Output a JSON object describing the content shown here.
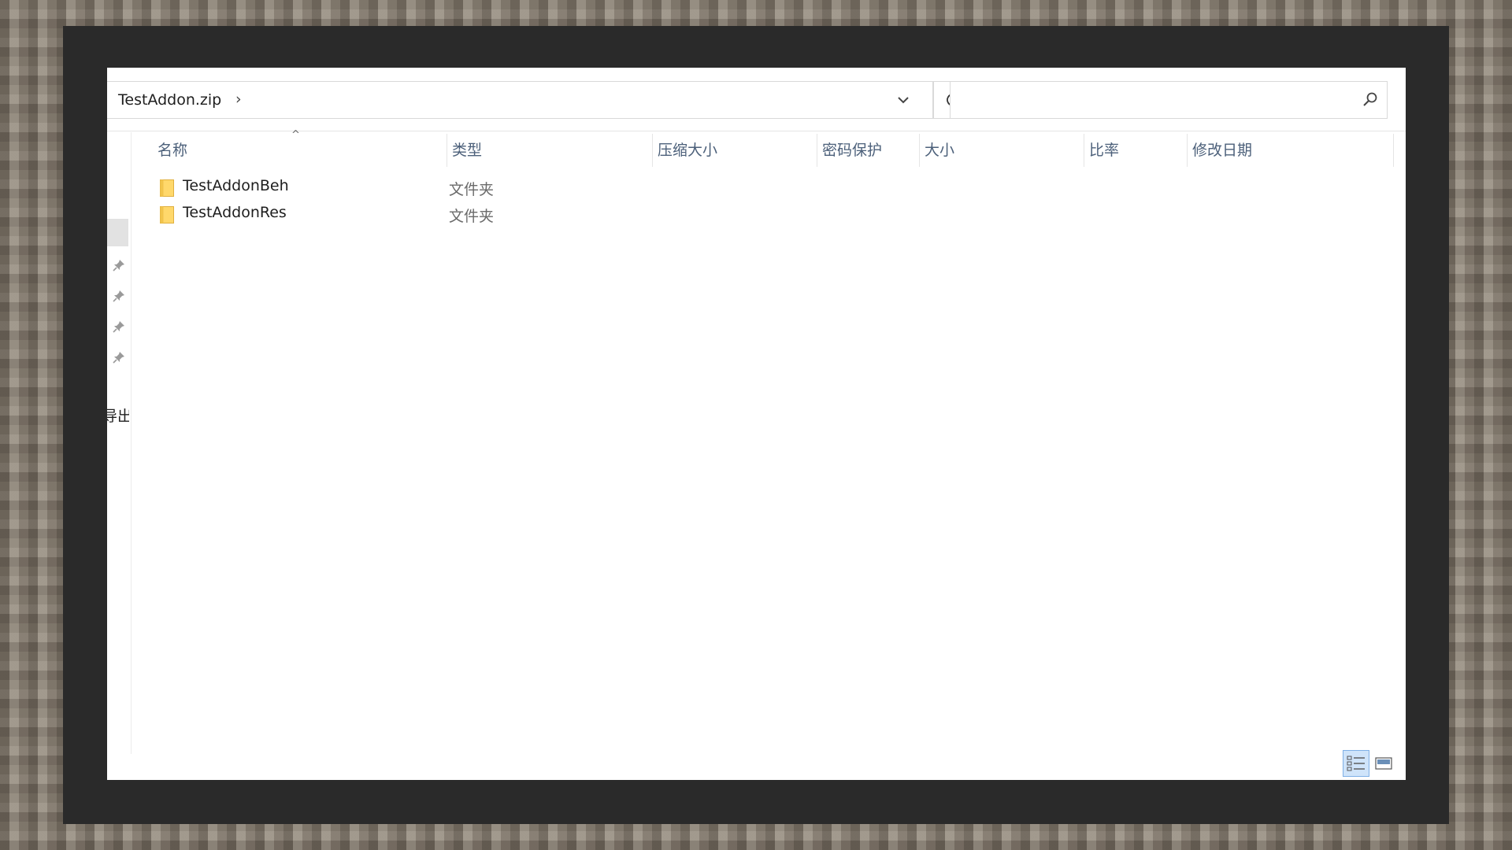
{
  "address": {
    "path_segment": "TestAddon.zip",
    "chevron": "›"
  },
  "search": {
    "placeholder": "",
    "value": ""
  },
  "nav": {
    "pinned_count": 4,
    "cut_label": "导出("
  },
  "columns": [
    {
      "label": "名称"
    },
    {
      "label": "类型"
    },
    {
      "label": "压缩大小"
    },
    {
      "label": "密码保护"
    },
    {
      "label": "大小"
    },
    {
      "label": "比率"
    },
    {
      "label": "修改日期"
    }
  ],
  "files": [
    {
      "name": "TestAddonBeh",
      "type": "文件夹",
      "icon": "folder-icon"
    },
    {
      "name": "TestAddonRes",
      "type": "文件夹",
      "icon": "folder-icon"
    }
  ],
  "icons": {
    "dropdown": "chevron-down-icon",
    "refresh": "refresh-icon",
    "search": "search-icon",
    "pin": "pin-icon",
    "details_view": "details-view-icon",
    "tiles_view": "large-icons-view-icon"
  },
  "colors": {
    "header_text": "#4c607a",
    "folder_fill": "#ffd86b",
    "selected_view_bg": "#cfe4fa",
    "frame": "#2a2a2a"
  }
}
